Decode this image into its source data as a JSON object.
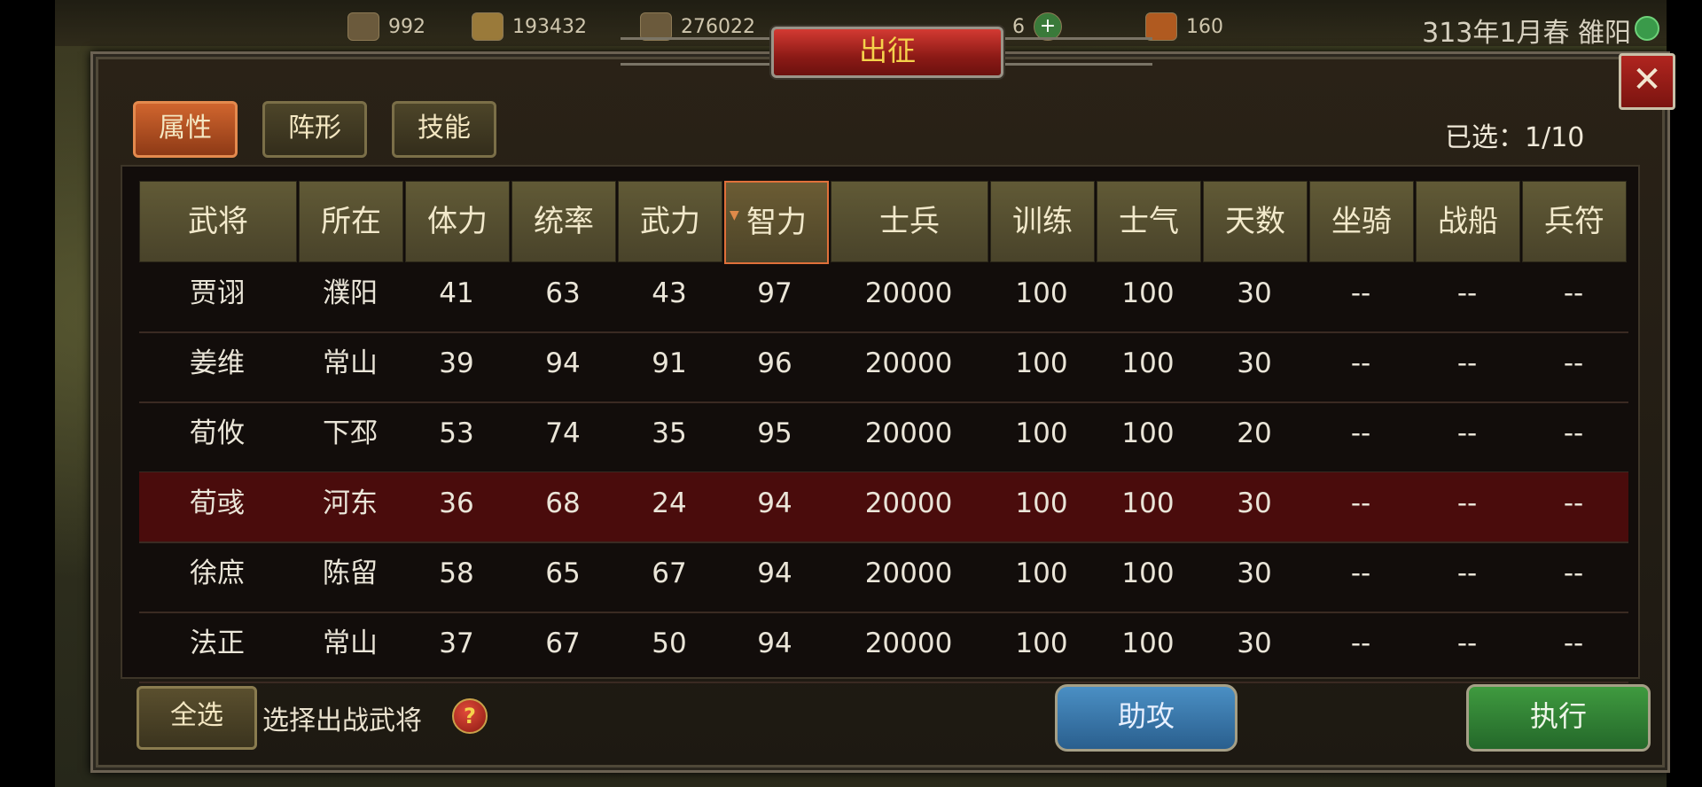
{
  "resources": [
    {
      "icon": "ore-icon",
      "value": "992"
    },
    {
      "icon": "gold-icon",
      "value": "193432"
    },
    {
      "icon": "wood-icon",
      "value": "276022"
    },
    {
      "icon": "food-icon",
      "value": ""
    },
    {
      "icon": "gem-icon",
      "value": "6"
    },
    {
      "icon": "scroll-icon",
      "value": "160"
    }
  ],
  "date_location": "313年1月春 雒阳",
  "dialog": {
    "title": "出征",
    "close": "✕",
    "tabs": [
      "属性",
      "阵形",
      "技能"
    ],
    "active_tab": 0,
    "selected_count": "已选：1/10"
  },
  "table": {
    "headers": [
      "武将",
      "所在",
      "体力",
      "统率",
      "武力",
      "智力",
      "士兵",
      "训练",
      "士气",
      "天数",
      "坐骑",
      "战船",
      "兵符"
    ],
    "sorted_column": 5,
    "rows": [
      [
        "贾诩",
        "濮阳",
        "41",
        "63",
        "43",
        "97",
        "20000",
        "100",
        "100",
        "30",
        "--",
        "--",
        "--"
      ],
      [
        "姜维",
        "常山",
        "39",
        "94",
        "91",
        "96",
        "20000",
        "100",
        "100",
        "30",
        "--",
        "--",
        "--"
      ],
      [
        "荀攸",
        "下邳",
        "53",
        "74",
        "35",
        "95",
        "20000",
        "100",
        "100",
        "20",
        "--",
        "--",
        "--"
      ],
      [
        "荀彧",
        "河东",
        "36",
        "68",
        "24",
        "94",
        "20000",
        "100",
        "100",
        "30",
        "--",
        "--",
        "--"
      ],
      [
        "徐庶",
        "陈留",
        "58",
        "65",
        "67",
        "94",
        "20000",
        "100",
        "100",
        "30",
        "--",
        "--",
        "--"
      ],
      [
        "法正",
        "常山",
        "37",
        "67",
        "50",
        "94",
        "20000",
        "100",
        "100",
        "30",
        "--",
        "--",
        "--"
      ]
    ],
    "highlighted_row": 3
  },
  "footer": {
    "select_all": "全选",
    "hint": "选择出战武将",
    "help": "?",
    "assist": "助攻",
    "execute": "执行"
  }
}
